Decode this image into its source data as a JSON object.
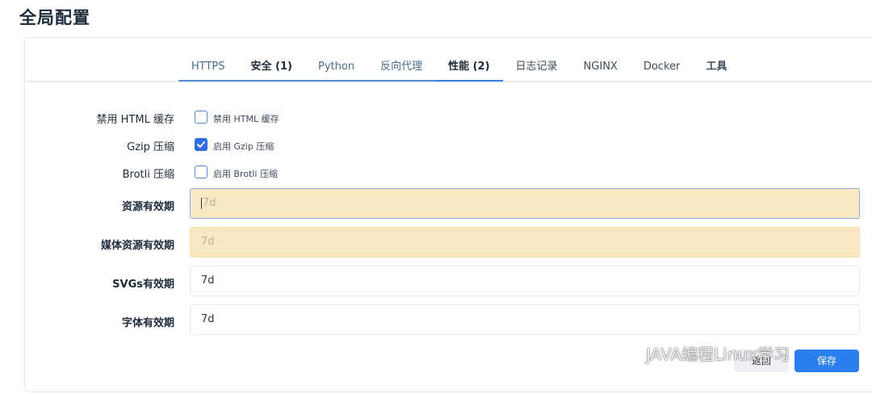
{
  "page": {
    "title": "全局配置"
  },
  "tabs": [
    {
      "label": "HTTPS"
    },
    {
      "label": "安全 (1)"
    },
    {
      "label": "Python"
    },
    {
      "label": "反向代理"
    },
    {
      "label": "性能 (2)"
    },
    {
      "label": "日志记录"
    },
    {
      "label": "NGINX"
    },
    {
      "label": "Docker"
    },
    {
      "label": "工具"
    }
  ],
  "active_tab": "性能 (2)",
  "form": {
    "disable_html_cache": {
      "label": "禁用 HTML 缓存",
      "checkbox_label": "禁用 HTML 缓存",
      "checked": false
    },
    "gzip": {
      "label": "Gzip 压缩",
      "checkbox_label": "启用 Gzip 压缩",
      "checked": true
    },
    "brotli": {
      "label": "Brotli 压缩",
      "checkbox_label": "启用 Brotli 压缩",
      "checked": false
    },
    "assets_expiry": {
      "label": "资源有效期",
      "placeholder": "7d",
      "value": ""
    },
    "media_expiry": {
      "label": "媒体资源有效期",
      "placeholder": "7d",
      "value": ""
    },
    "svg_expiry": {
      "label": "SVGs有效期",
      "value": "7d"
    },
    "font_expiry": {
      "label": "字体有效期",
      "value": "7d"
    }
  },
  "buttons": {
    "back": "返回",
    "save": "保存"
  },
  "watermark": {
    "text": "JAVA编程Linux学习"
  },
  "colors": {
    "accent": "#2d7ff0",
    "warning_bg": "#f9e9c2",
    "tab_underline": "#5b8bd6"
  }
}
